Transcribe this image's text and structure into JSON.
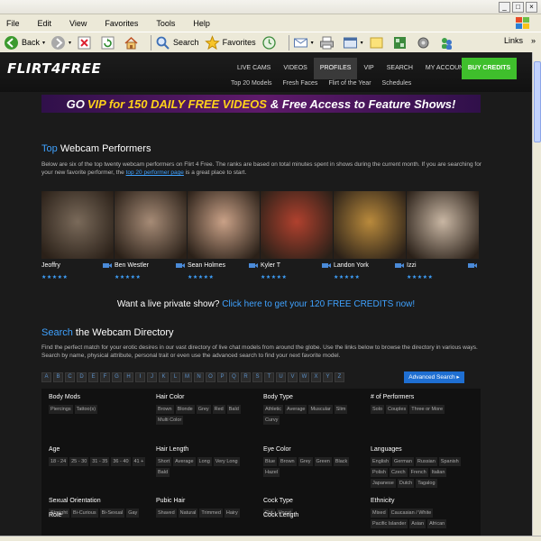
{
  "browser": {
    "menu": [
      "File",
      "Edit",
      "View",
      "Favorites",
      "Tools",
      "Help"
    ],
    "toolbar": {
      "back": "Back",
      "search": "Search",
      "favorites": "Favorites",
      "links": "Links"
    }
  },
  "site": {
    "logo_left": "FLIRT",
    "logo_four": "4",
    "logo_right": "FREE",
    "nav": [
      "LIVE CAMS",
      "VIDEOS",
      "PROFILES",
      "VIP",
      "SEARCH",
      "MY ACCOUNT"
    ],
    "active_nav": "PROFILES",
    "buy_credits": "BUY CREDITS",
    "sub_nav": [
      "Top 20 Models",
      "Fresh Faces",
      "Flirt of the Year",
      "Schedules"
    ]
  },
  "banner": {
    "pre": "GO",
    "vip": "VIP",
    "mid": "for 150 DAILY FREE VIDEOS",
    "post": "& Free Access to Feature Shows!"
  },
  "top_section": {
    "title_hl": "Top",
    "title_rest": "Webcam Performers",
    "desc_1": "Below are six of the top twenty webcam performers on Flirt 4 Free. The ranks are based on total minutes spent in shows during the current month. If you are searching for your new favorite performer, the",
    "desc_link": "top 20 performer page",
    "desc_2": "is a great place to start."
  },
  "performers": [
    {
      "name": "Jeoffry",
      "stars": "★★★★★",
      "color": "#7a6a5a"
    },
    {
      "name": "Ben Westler",
      "stars": "★★★★★",
      "color": "#a68b76"
    },
    {
      "name": "Sean Holmes",
      "stars": "★★★★★",
      "color": "#c9a187"
    },
    {
      "name": "Kyler T",
      "stars": "★★★★★",
      "color": "#b0412e"
    },
    {
      "name": "Landon York",
      "stars": "★★★★★",
      "color": "#b98a3c"
    },
    {
      "name": "Izzi",
      "stars": "★★★★★",
      "color": "#c8b6a3"
    }
  ],
  "private_show": {
    "text": "Want a live private show?",
    "link": "Click here to get your 120 FREE CREDITS now!"
  },
  "directory": {
    "title_hl": "Search",
    "title_rest": "the Webcam Directory",
    "desc": "Find the perfect match for your erotic desires in our vast directory of live chat models from around the globe. Use the links below to browse the directory in various ways. Search by name, physical attribute, personal trait or even use the advanced search to find your next favorite model.",
    "letters": [
      "A",
      "B",
      "C",
      "D",
      "E",
      "F",
      "G",
      "H",
      "I",
      "J",
      "K",
      "L",
      "M",
      "N",
      "O",
      "P",
      "Q",
      "R",
      "S",
      "T",
      "U",
      "V",
      "W",
      "X",
      "Y",
      "Z"
    ],
    "advanced": "Advanced Search ▸",
    "groups": [
      {
        "title": "Body Mods",
        "options": [
          "Piercings",
          "Tattoo(s)"
        ]
      },
      {
        "title": "Hair Color",
        "options": [
          "Brown",
          "Blonde",
          "Grey",
          "Red",
          "Bald",
          "Multi Color"
        ]
      },
      {
        "title": "Body Type",
        "options": [
          "Athletic",
          "Average",
          "Muscular",
          "Slim",
          "Curvy"
        ]
      },
      {
        "title": "# of Performers",
        "options": [
          "Solo",
          "Couples",
          "Three or More"
        ]
      },
      {
        "title": "Age",
        "options": [
          "18 - 24",
          "25 - 30",
          "31 - 35",
          "36 - 40",
          "41 +"
        ]
      },
      {
        "title": "Hair Length",
        "options": [
          "Short",
          "Average",
          "Long",
          "Very Long",
          "Bald"
        ]
      },
      {
        "title": "Eye Color",
        "options": [
          "Blue",
          "Brown",
          "Grey",
          "Green",
          "Black",
          "Hazel"
        ]
      },
      {
        "title": "Languages",
        "options": [
          "English",
          "German",
          "Russian",
          "Spanish",
          "Polish",
          "Czech",
          "French",
          "Italian",
          "Japanese",
          "Dutch",
          "Tagalog"
        ]
      },
      {
        "title": "Sexual Orientation",
        "options": [
          "Straight",
          "Bi-Curious",
          "Bi-Sexual",
          "Gay"
        ]
      },
      {
        "title": "Pubic Hair",
        "options": [
          "Shaved",
          "Natural",
          "Trimmed",
          "Hairy"
        ]
      },
      {
        "title": "Cock Type",
        "options": [
          "Cut",
          "Uncut"
        ]
      },
      {
        "title": "Ethnicity",
        "options": [
          "Mixed",
          "Caucasian / White",
          "Pacific Islander",
          "Asian",
          "African"
        ]
      },
      {
        "title": "Role",
        "options": []
      },
      {
        "title": "Cock Length",
        "options": []
      }
    ]
  }
}
